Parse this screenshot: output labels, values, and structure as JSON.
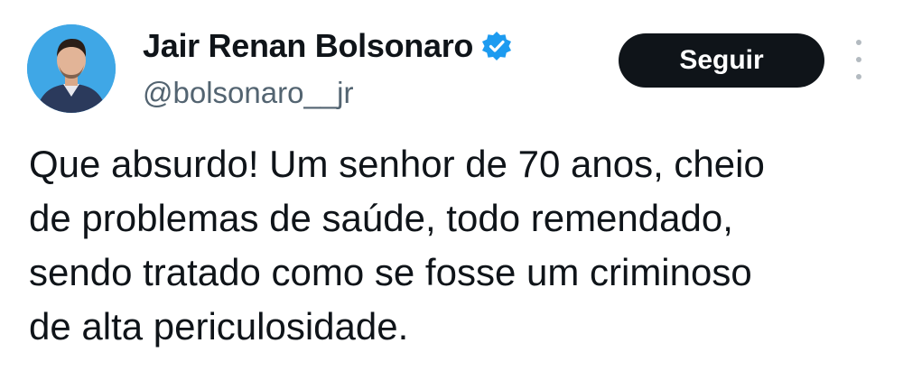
{
  "author": {
    "display_name": "Jair Renan Bolsonaro",
    "handle": "@bolsonaro__jr",
    "verified": true
  },
  "actions": {
    "follow_label": "Seguir"
  },
  "tweet": {
    "text_lines": [
      "Que absurdo! Um senhor de 70 anos, cheio",
      "de problemas de saúde, todo remendado,",
      "sendo tratado como se fosse um criminoso",
      "de alta periculosidade."
    ]
  },
  "colors": {
    "text": "#0f1419",
    "secondary_text": "#536471",
    "button_bg": "#0f1419",
    "verified_badge": "#1d9bf0",
    "avatar_bg": "#3fa7e6"
  },
  "icons": {
    "verified": "verified-badge-icon",
    "more": "more-vertical-icon"
  }
}
